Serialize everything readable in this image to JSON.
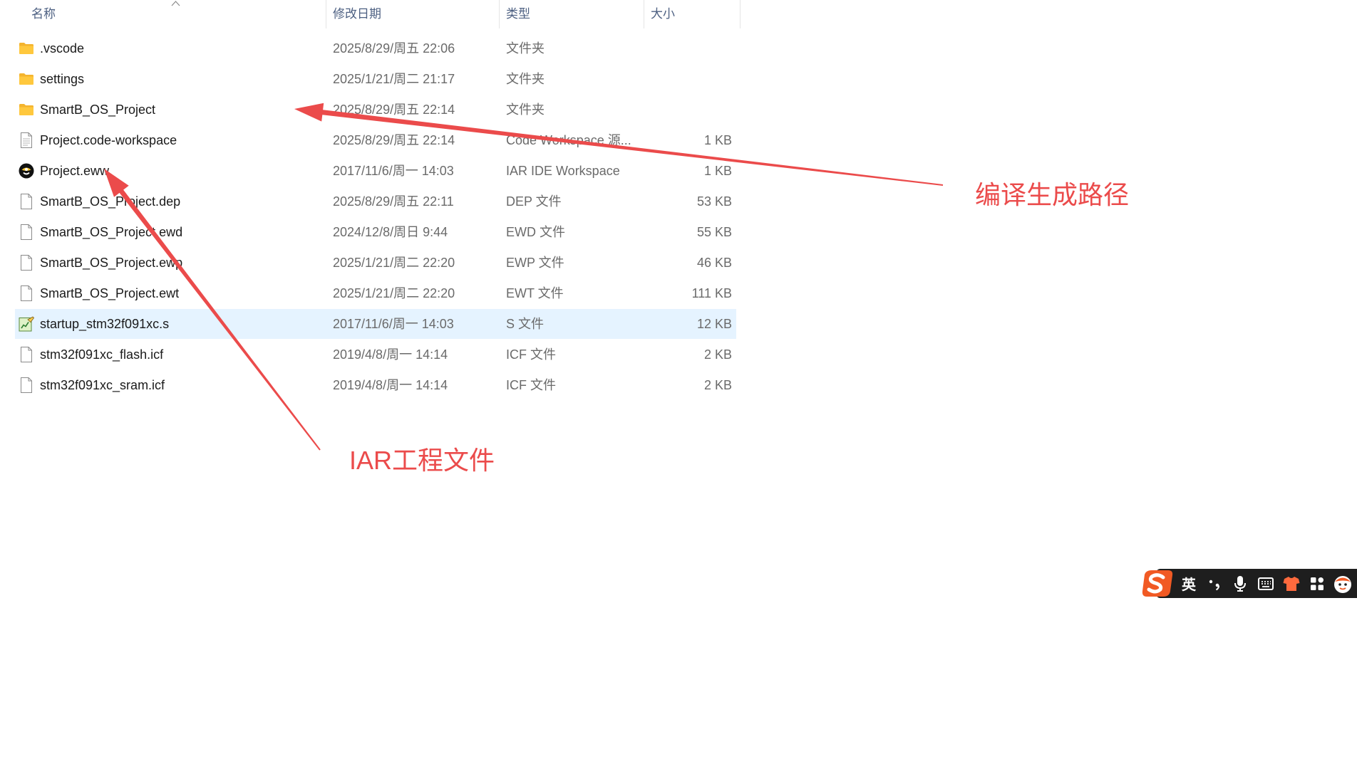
{
  "columns": {
    "name": "名称",
    "modified": "修改日期",
    "type": "类型",
    "size": "大小",
    "sort_icon": "chevron-up-icon"
  },
  "files": [
    {
      "name": ".vscode",
      "modified": "2025/8/29/周五 22:06",
      "type": "文件夹",
      "size": "",
      "icon": "folder-icon",
      "selected": false
    },
    {
      "name": "settings",
      "modified": "2025/1/21/周二 21:17",
      "type": "文件夹",
      "size": "",
      "icon": "folder-icon",
      "selected": false
    },
    {
      "name": "SmartB_OS_Project",
      "modified": "2025/8/29/周五 22:14",
      "type": "文件夹",
      "size": "",
      "icon": "folder-icon",
      "selected": false
    },
    {
      "name": "Project.code-workspace",
      "modified": "2025/8/29/周五 22:14",
      "type": "Code Workspace 源...",
      "size": "1 KB",
      "icon": "document-icon",
      "selected": false
    },
    {
      "name": "Project.eww",
      "modified": "2017/11/6/周一 14:03",
      "type": "IAR IDE Workspace",
      "size": "1 KB",
      "icon": "iar-icon",
      "selected": false
    },
    {
      "name": "SmartB_OS_Project.dep",
      "modified": "2025/8/29/周五 22:11",
      "type": "DEP 文件",
      "size": "53 KB",
      "icon": "file-icon",
      "selected": false
    },
    {
      "name": "SmartB_OS_Project.ewd",
      "modified": "2024/12/8/周日 9:44",
      "type": "EWD 文件",
      "size": "55 KB",
      "icon": "file-icon",
      "selected": false
    },
    {
      "name": "SmartB_OS_Project.ewp",
      "modified": "2025/1/21/周二 22:20",
      "type": "EWP 文件",
      "size": "46 KB",
      "icon": "file-icon",
      "selected": false
    },
    {
      "name": "SmartB_OS_Project.ewt",
      "modified": "2025/1/21/周二 22:20",
      "type": "EWT 文件",
      "size": "111 KB",
      "icon": "file-icon",
      "selected": false
    },
    {
      "name": "startup_stm32f091xc.s",
      "modified": "2017/11/6/周一 14:03",
      "type": "S 文件",
      "size": "12 KB",
      "icon": "source-file-icon",
      "selected": true
    },
    {
      "name": "stm32f091xc_flash.icf",
      "modified": "2019/4/8/周一 14:14",
      "type": "ICF 文件",
      "size": "2 KB",
      "icon": "file-icon",
      "selected": false
    },
    {
      "name": "stm32f091xc_sram.icf",
      "modified": "2019/4/8/周一 14:14",
      "type": "ICF 文件",
      "size": "2 KB",
      "icon": "file-icon",
      "selected": false
    }
  ],
  "annotations": {
    "build_output_path": "编译生成路径",
    "iar_project_file": "IAR工程文件"
  },
  "ime_toolbar": {
    "logo": "S",
    "mode": "英",
    "icons": [
      "sogou-logo-icon",
      "punctuation-icon",
      "microphone-icon",
      "keyboard-icon",
      "skin-icon",
      "toolbox-icon",
      "mascot-icon"
    ]
  },
  "colors": {
    "annotation": "#eb4b4b",
    "selection": "#e5f3ff",
    "header_text": "#4d6082",
    "ime_bar": "#1e1e1e",
    "ime_logo": "#f15a24",
    "folder": "#ffc83d"
  }
}
